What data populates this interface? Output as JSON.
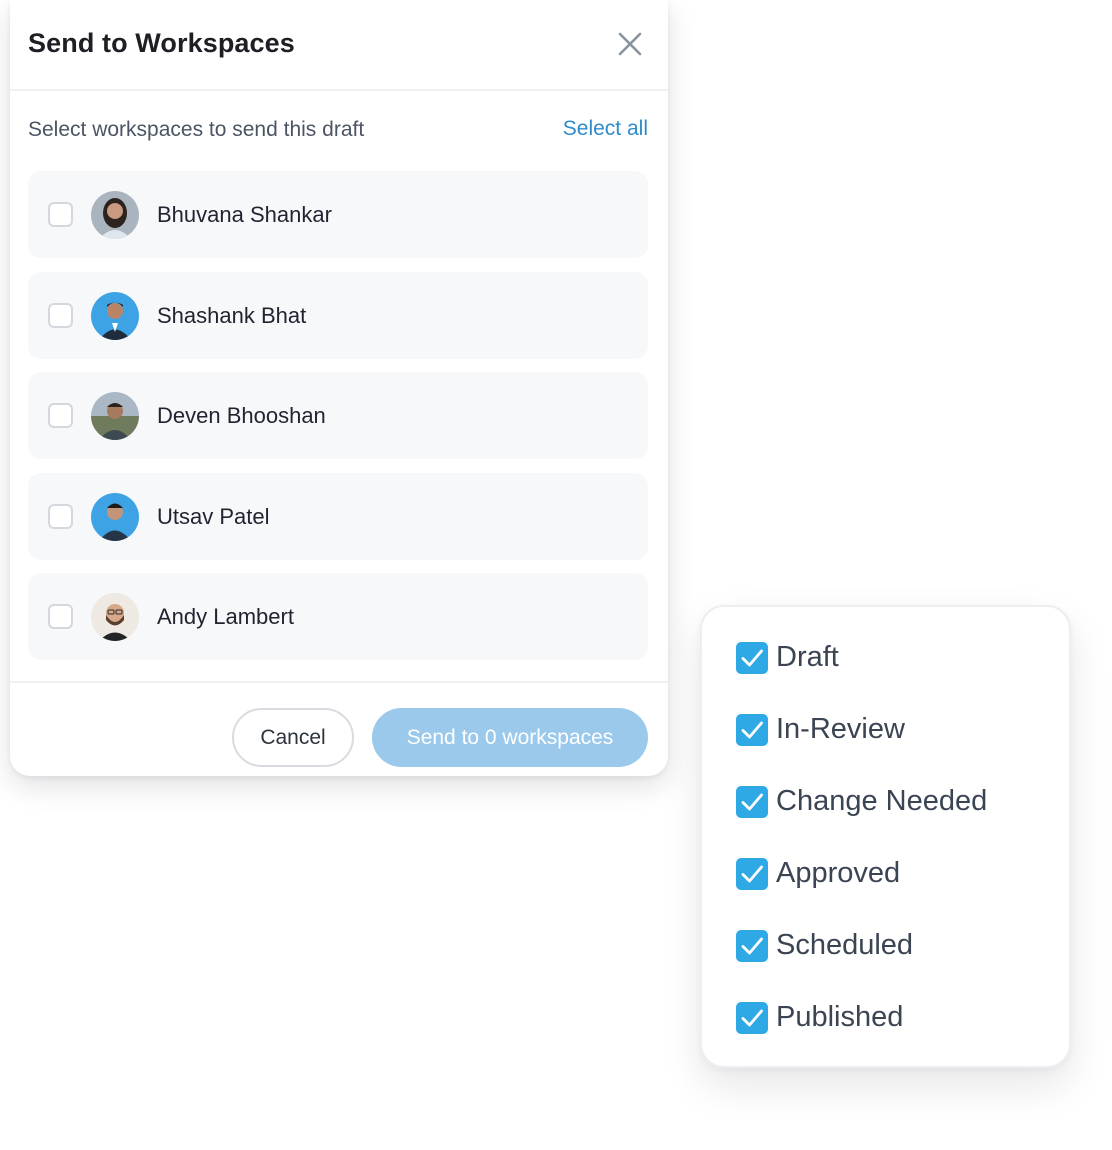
{
  "modal": {
    "title": "Send to Workspaces",
    "subtitle": "Select workspaces to send this draft",
    "select_all_label": "Select all",
    "workspaces": [
      {
        "name": "Bhuvana Shankar",
        "checked": false
      },
      {
        "name": "Shashank Bhat",
        "checked": false
      },
      {
        "name": "Deven Bhooshan",
        "checked": false
      },
      {
        "name": "Utsav Patel",
        "checked": false
      },
      {
        "name": "Andy Lambert",
        "checked": false
      }
    ],
    "cancel_label": "Cancel",
    "send_label": "Send to 0 workspaces"
  },
  "status_filter": {
    "items": [
      {
        "label": "Draft",
        "checked": true
      },
      {
        "label": "In-Review",
        "checked": true
      },
      {
        "label": "Change Needed",
        "checked": true
      },
      {
        "label": "Approved",
        "checked": true
      },
      {
        "label": "Scheduled",
        "checked": true
      },
      {
        "label": "Published",
        "checked": true
      }
    ]
  },
  "colors": {
    "accent": "#2fa9e6",
    "link": "#2e8bc9",
    "send_button_disabled": "#9ac9ec"
  },
  "icons": {
    "close": "close-icon",
    "checkmark": "checkmark-icon"
  }
}
